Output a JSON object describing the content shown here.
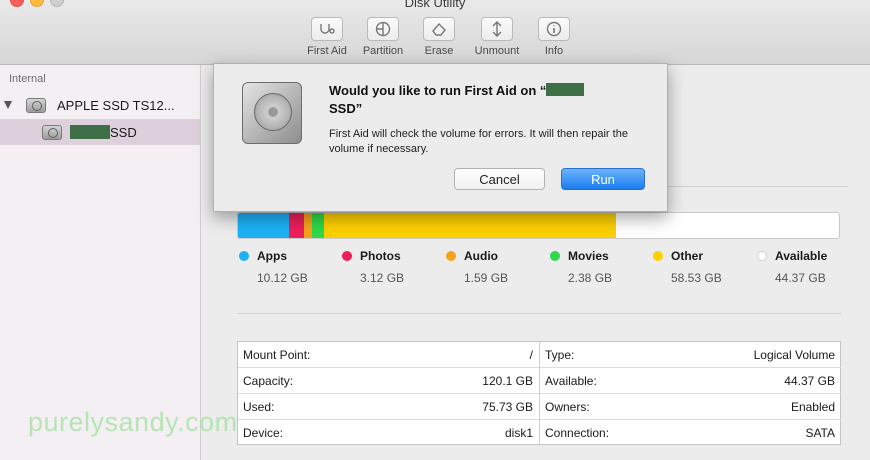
{
  "window": {
    "title": "Disk Utility"
  },
  "toolbar": {
    "items": [
      {
        "label": "First Aid",
        "icon": "stethoscope-icon"
      },
      {
        "label": "Partition",
        "icon": "partition-icon"
      },
      {
        "label": "Erase",
        "icon": "erase-icon"
      },
      {
        "label": "Unmount",
        "icon": "unmount-icon"
      },
      {
        "label": "Info",
        "icon": "info-icon"
      }
    ]
  },
  "sidebar": {
    "section_label": "Internal",
    "disk_label": "APPLE SSD TS12...",
    "volume_label_suffix": "SSD"
  },
  "dialog": {
    "title_line1": "Would you like to run First Aid on “",
    "title_line2": "SSD”",
    "message": "First Aid will check the volume for errors. It will then repair the volume if necessary.",
    "cancel_label": "Cancel",
    "run_label": "Run"
  },
  "usage": {
    "segments": [
      {
        "name": "Apps",
        "value": "10.12 GB",
        "color": "#1cb2f5",
        "fraction": 0.0843
      },
      {
        "name": "Photos",
        "value": "3.12 GB",
        "color": "#ee1e5b",
        "fraction": 0.0254
      },
      {
        "name": "Audio",
        "value": "1.59 GB",
        "color": "#f7a21a",
        "fraction": 0.013
      },
      {
        "name": "Movies",
        "value": "2.38 GB",
        "color": "#2fd94a",
        "fraction": 0.0198
      },
      {
        "name": "Other",
        "value": "58.53 GB",
        "color": "#fdd000",
        "fraction": 0.4873
      },
      {
        "name": "Available",
        "value": "44.37 GB",
        "color": "#ffffff",
        "fraction": 0.3694
      }
    ]
  },
  "info": {
    "left": [
      {
        "key": "Mount Point:",
        "value": "/"
      },
      {
        "key": "Capacity:",
        "value": "120.1 GB"
      },
      {
        "key": "Used:",
        "value": "75.73 GB"
      },
      {
        "key": "Device:",
        "value": "disk1"
      }
    ],
    "right": [
      {
        "key": "Type:",
        "value": "Logical Volume"
      },
      {
        "key": "Available:",
        "value": "44.37 GB"
      },
      {
        "key": "Owners:",
        "value": "Enabled"
      },
      {
        "key": "Connection:",
        "value": "SATA"
      }
    ]
  },
  "watermark": "purelysandy.com",
  "colors": {
    "run_button": "#1b7cf2",
    "selected_row": "#ddd0dc",
    "redaction": "#3e6f47"
  }
}
